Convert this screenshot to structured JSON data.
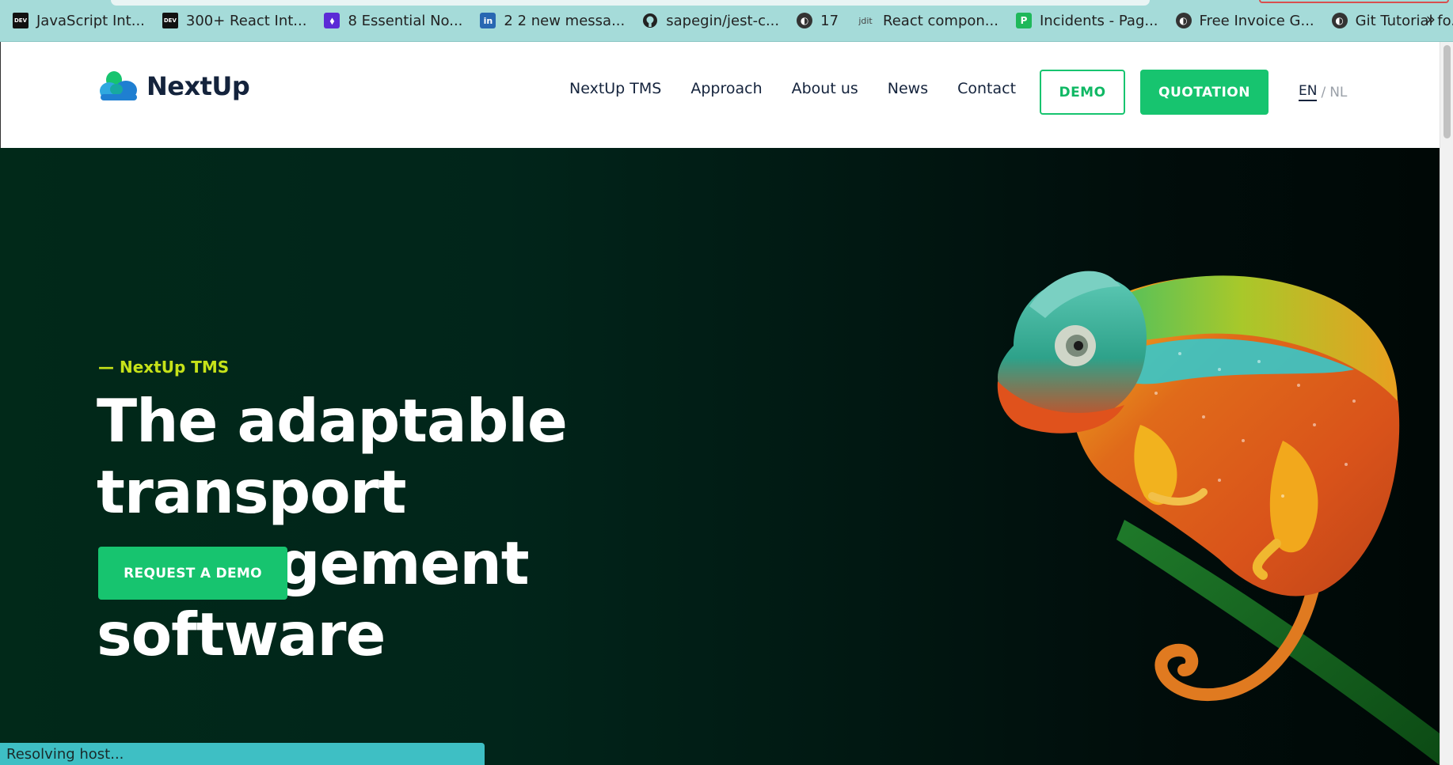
{
  "bookmarks": [
    {
      "label": "JavaScript Int...",
      "icon": "dev-icon"
    },
    {
      "label": "300+ React Int...",
      "icon": "dev-icon"
    },
    {
      "label": "8 Essential No...",
      "icon": "purple-app-icon"
    },
    {
      "label": "2 2 new messa...",
      "icon": "linkedin-icon"
    },
    {
      "label": "sapegin/jest-c...",
      "icon": "github-icon"
    },
    {
      "label": "17",
      "icon": "globe-icon"
    },
    {
      "label": "React compon...",
      "icon": "jdit-icon"
    },
    {
      "label": "Incidents - Pag...",
      "icon": "pagerduty-icon"
    },
    {
      "label": "Free Invoice G...",
      "icon": "globe-icon"
    },
    {
      "label": "Git Tutorial fo...",
      "icon": "globe-icon"
    }
  ],
  "bookmarks_more": "»",
  "icon_glyphs": {
    "dev": "DEV",
    "purple": "⬧",
    "linkedin": "in",
    "globe": "◐",
    "jdit": "jdit",
    "pager": "P"
  },
  "logo": {
    "text": "NextUp"
  },
  "nav": {
    "items": [
      "NextUp TMS",
      "Approach",
      "About us",
      "News",
      "Contact"
    ],
    "demo_label": "DEMO",
    "quotation_label": "QUOTATION",
    "lang_active": "EN",
    "lang_sep": "/",
    "lang_other": "NL"
  },
  "hero": {
    "eyebrow": "— NextUp TMS",
    "title_line1": "The adaptable transport",
    "title_line2": "management software",
    "cta_label": "REQUEST A DEMO"
  },
  "status": {
    "text": "Resolving host..."
  },
  "colors": {
    "brand_green": "#17c46f",
    "accent_lime": "#c6e219",
    "navy": "#14233c",
    "hero_bg": "#012919",
    "bookmarks_bg": "#a5dbd9"
  }
}
